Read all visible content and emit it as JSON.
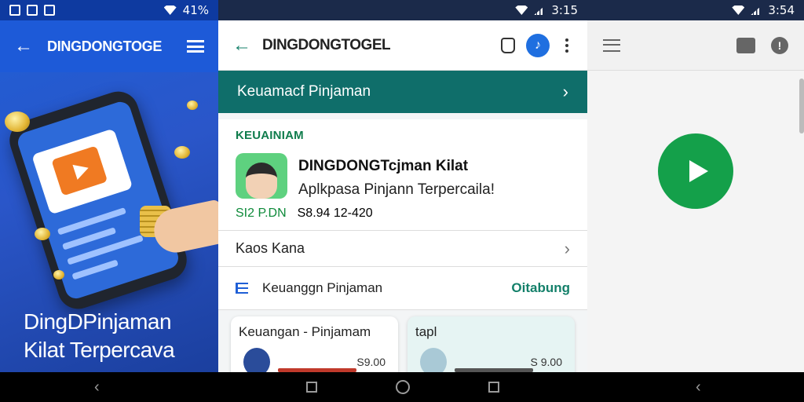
{
  "left": {
    "status": {
      "battery": "41%"
    },
    "appbar": {
      "title": "DINGDONGTOGE"
    },
    "hero_text_line1": "DingDPinjaman",
    "hero_text_line2": "Kilat Terpercava"
  },
  "mid": {
    "status": {
      "time": "3:15"
    },
    "appbar": {
      "title": "DINGDONGTOGEL"
    },
    "banner": {
      "label": "Keuamacf Pinjaman"
    },
    "section": {
      "title": "KEUAINIAM",
      "app_name": "DINGDONGTcjman Kilat",
      "app_subtitle": "Aplkpasa Pinjann Terpercaila!",
      "price_green": "SI2 P.DN",
      "price_value": "S8.94 12-420"
    },
    "row1": {
      "label": "Kaos Kana"
    },
    "row2": {
      "label": "Keuanggn Pinjaman",
      "action": "Oitabung"
    },
    "cards": [
      {
        "title": "Keuangan - Pinjamam",
        "price": "S9.00"
      },
      {
        "title": "tapl",
        "price": "S 9.00"
      }
    ]
  },
  "right": {
    "status": {
      "time": "3:54"
    }
  },
  "colors": {
    "left_bg": "#2a56c9",
    "teal_banner": "#0f6e6a",
    "green_accent": "#0e8a3a",
    "play_green": "#14a04a"
  }
}
